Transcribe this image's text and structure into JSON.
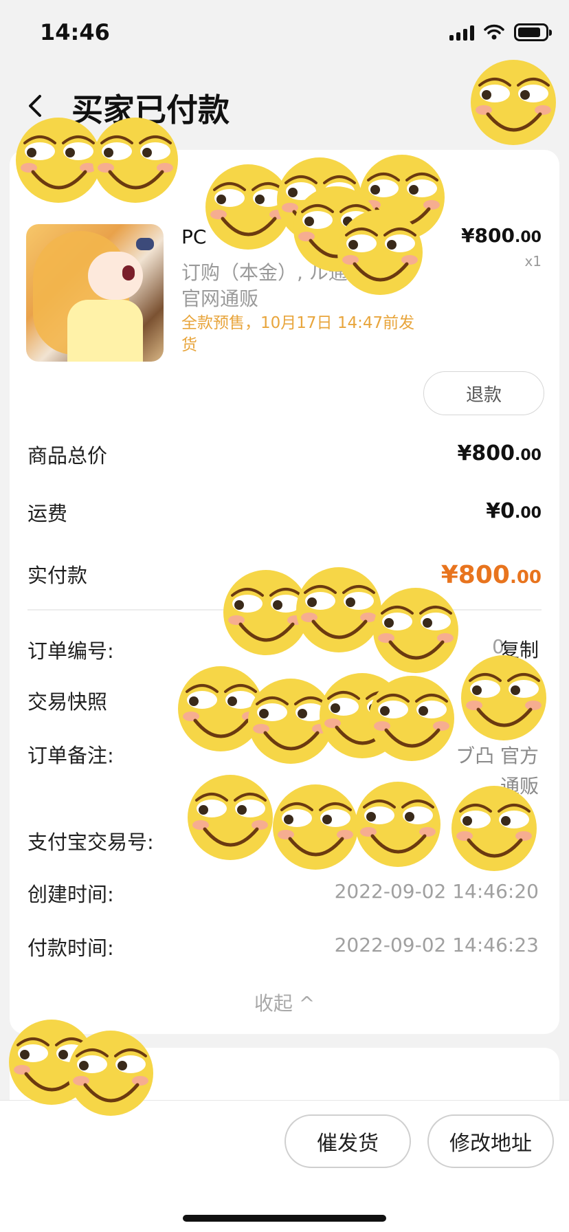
{
  "status_bar": {
    "time": "14:46",
    "battery_level": 0.85
  },
  "header": {
    "title": "买家已付款"
  },
  "product": {
    "title": "PC",
    "spec": "订购（本金）, ル通販 官网通贩",
    "presale_note": "全款预售，10月17日 14:47前发货",
    "price_main": "¥800",
    "price_cents": ".00",
    "quantity": "x1",
    "refund_label": "退款"
  },
  "summary": {
    "subtotal_label": "商品总价",
    "subtotal_main": "¥800",
    "subtotal_cents": ".00",
    "shipping_label": "运费",
    "shipping_main": "¥0",
    "shipping_cents": ".00",
    "paid_label": "实付款",
    "paid_main": "¥800",
    "paid_cents": ".00"
  },
  "order_info": {
    "order_no_label": "订单编号:",
    "order_no_value": "0",
    "copy_label": "复制",
    "snapshot_label": "交易快照",
    "note_label": "订单备注:",
    "note_value_line1": "ブ凸 官方",
    "note_value_line2": "通贩",
    "alipay_label": "支付宝交易号:",
    "created_label": "创建时间:",
    "created_value": "2022-09-02 14:46:20",
    "paid_time_label": "付款时间:",
    "paid_time_value": "2022-09-02 14:46:23",
    "collapse_label": "收起 ^"
  },
  "actions": {
    "urge_label": "催发货",
    "address_label": "修改地址"
  },
  "colors": {
    "accent_orange": "#e8741e",
    "presale_orange": "#e8a53c",
    "sticker_yellow": "#f6d647"
  },
  "icons": {
    "back": "chevron-left-icon",
    "collapse": "chevron-up-icon",
    "sticker": "smirk-emoji-icon"
  }
}
